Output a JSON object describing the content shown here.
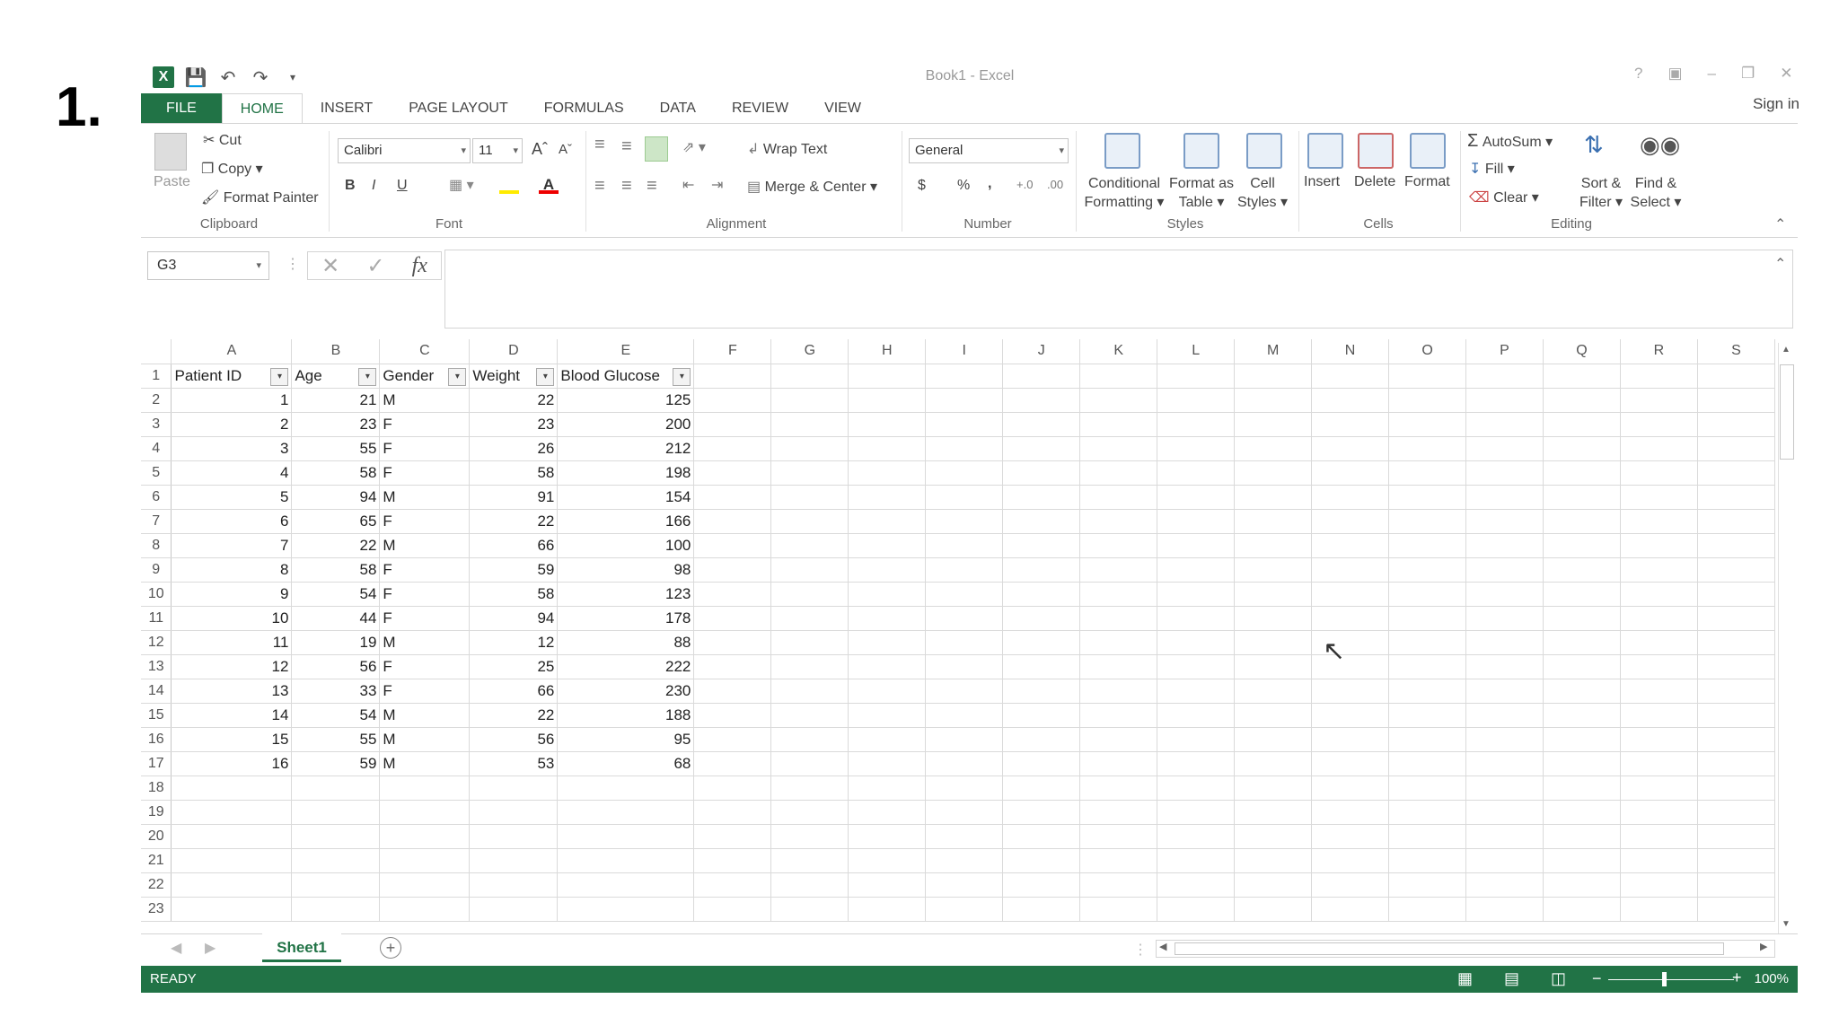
{
  "step_label": "1.",
  "app": {
    "title": "Book1 - Excel",
    "sign_in": "Sign in"
  },
  "tabs": [
    "FILE",
    "HOME",
    "INSERT",
    "PAGE LAYOUT",
    "FORMULAS",
    "DATA",
    "REVIEW",
    "VIEW"
  ],
  "ribbon": {
    "clipboard": {
      "paste": "Paste",
      "cut": "Cut",
      "copy": "Copy",
      "format_painter": "Format Painter",
      "label": "Clipboard"
    },
    "font": {
      "name": "Calibri",
      "size": "11",
      "label": "Font",
      "bold": "B",
      "italic": "I",
      "underline": "U"
    },
    "alignment": {
      "wrap": "Wrap Text",
      "merge": "Merge & Center",
      "label": "Alignment"
    },
    "number": {
      "format": "General",
      "currency": "$",
      "percent": "%",
      "comma": ",",
      "label": "Number"
    },
    "styles": {
      "conditional_1": "Conditional",
      "conditional_2": "Formatting",
      "format_table_1": "Format as",
      "format_table_2": "Table",
      "cell_styles_1": "Cell",
      "cell_styles_2": "Styles",
      "label": "Styles"
    },
    "cells": {
      "insert": "Insert",
      "delete": "Delete",
      "format": "Format",
      "label": "Cells"
    },
    "editing": {
      "autosum": "AutoSum",
      "fill": "Fill",
      "clear": "Clear",
      "sort_1": "Sort &",
      "sort_2": "Filter",
      "find_1": "Find &",
      "find_2": "Select",
      "label": "Editing"
    }
  },
  "formula_bar": {
    "name_box": "G3",
    "fx": "fx",
    "content": ""
  },
  "columns": [
    "A",
    "B",
    "C",
    "D",
    "E",
    "F",
    "G",
    "H",
    "I",
    "J",
    "K",
    "L",
    "M",
    "N",
    "O",
    "P",
    "Q",
    "R",
    "S"
  ],
  "headers": [
    "Patient ID",
    "Age",
    "Gender",
    "Weight",
    "Blood Glucose"
  ],
  "rows": [
    [
      "1",
      "21",
      "M",
      "22",
      "125"
    ],
    [
      "2",
      "23",
      "F",
      "23",
      "200"
    ],
    [
      "3",
      "55",
      "F",
      "26",
      "212"
    ],
    [
      "4",
      "58",
      "F",
      "58",
      "198"
    ],
    [
      "5",
      "94",
      "M",
      "91",
      "154"
    ],
    [
      "6",
      "65",
      "F",
      "22",
      "166"
    ],
    [
      "7",
      "22",
      "M",
      "66",
      "100"
    ],
    [
      "8",
      "58",
      "F",
      "59",
      "98"
    ],
    [
      "9",
      "54",
      "F",
      "58",
      "123"
    ],
    [
      "10",
      "44",
      "F",
      "94",
      "178"
    ],
    [
      "11",
      "19",
      "M",
      "12",
      "88"
    ],
    [
      "12",
      "56",
      "F",
      "25",
      "222"
    ],
    [
      "13",
      "33",
      "F",
      "66",
      "230"
    ],
    [
      "14",
      "54",
      "M",
      "22",
      "188"
    ],
    [
      "15",
      "55",
      "M",
      "56",
      "95"
    ],
    [
      "16",
      "59",
      "M",
      "53",
      "68"
    ]
  ],
  "row_numbers": [
    "1",
    "2",
    "3",
    "4",
    "5",
    "6",
    "7",
    "8",
    "9",
    "10",
    "11",
    "12",
    "13",
    "14",
    "15",
    "16",
    "17",
    "18",
    "19",
    "20",
    "21",
    "22",
    "23"
  ],
  "sheet_tab": "Sheet1",
  "status": {
    "ready": "READY",
    "zoom": "100%"
  },
  "colors": {
    "accent": "#217346"
  }
}
